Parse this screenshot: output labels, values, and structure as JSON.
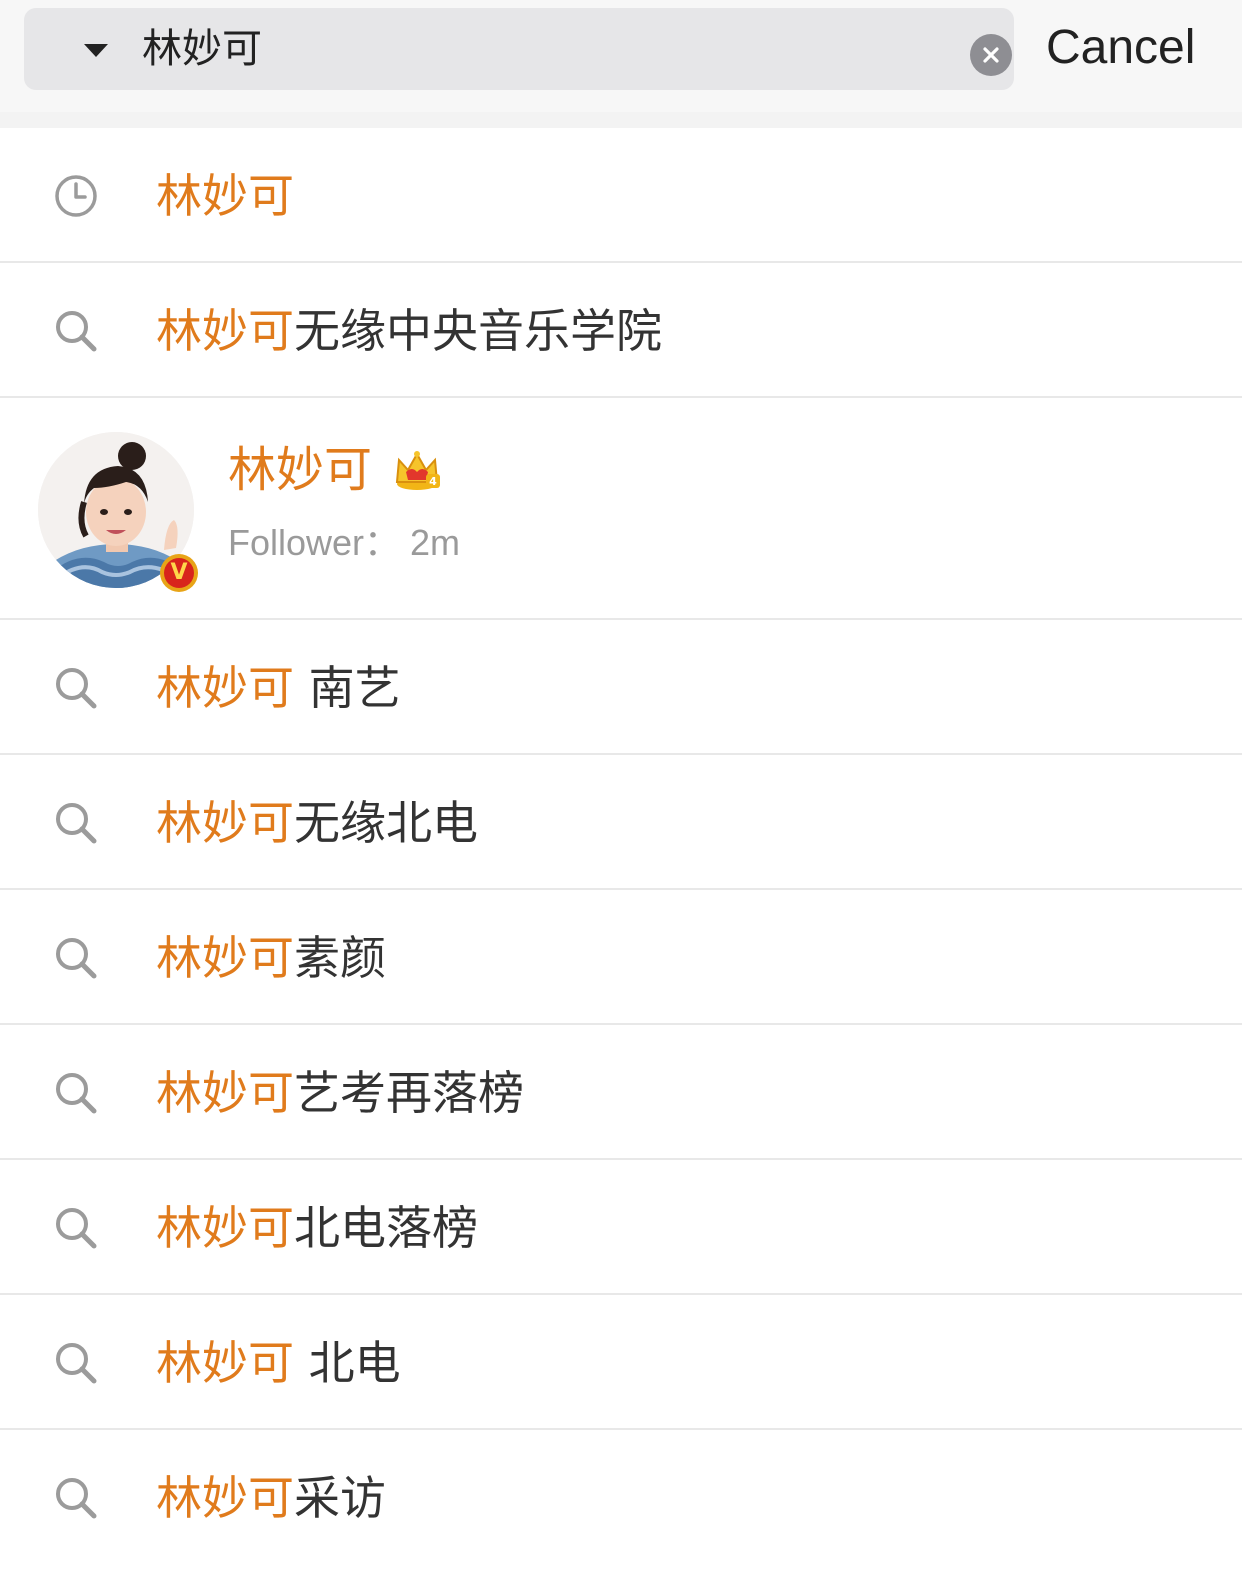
{
  "search": {
    "query": "林妙可",
    "cancel_label": "Cancel"
  },
  "history_item": {
    "icon": "clock-icon",
    "highlight": "林妙可",
    "rest": ""
  },
  "suggestions_top": [
    {
      "icon": "search-icon",
      "highlight": "林妙可",
      "rest": "无缘中央音乐学院"
    }
  ],
  "user_card": {
    "name": "林妙可",
    "follower_text": "Follower：  2m",
    "badge_letter": "V",
    "crown_icon": "crown-icon",
    "crown_level": "4"
  },
  "suggestions": [
    {
      "icon": "search-icon",
      "highlight": "林妙可",
      "rest": " 南艺"
    },
    {
      "icon": "search-icon",
      "highlight": "林妙可",
      "rest": "无缘北电"
    },
    {
      "icon": "search-icon",
      "highlight": "林妙可",
      "rest": "素颜"
    },
    {
      "icon": "search-icon",
      "highlight": "林妙可",
      "rest": "艺考再落榜"
    },
    {
      "icon": "search-icon",
      "highlight": "林妙可",
      "rest": "北电落榜"
    },
    {
      "icon": "search-icon",
      "highlight": "林妙可",
      "rest": " 北电"
    },
    {
      "icon": "search-icon",
      "highlight": "林妙可",
      "rest": "采访"
    }
  ],
  "colors": {
    "highlight": "#e07b1c",
    "text": "#333333",
    "muted": "#9a9a9a"
  }
}
